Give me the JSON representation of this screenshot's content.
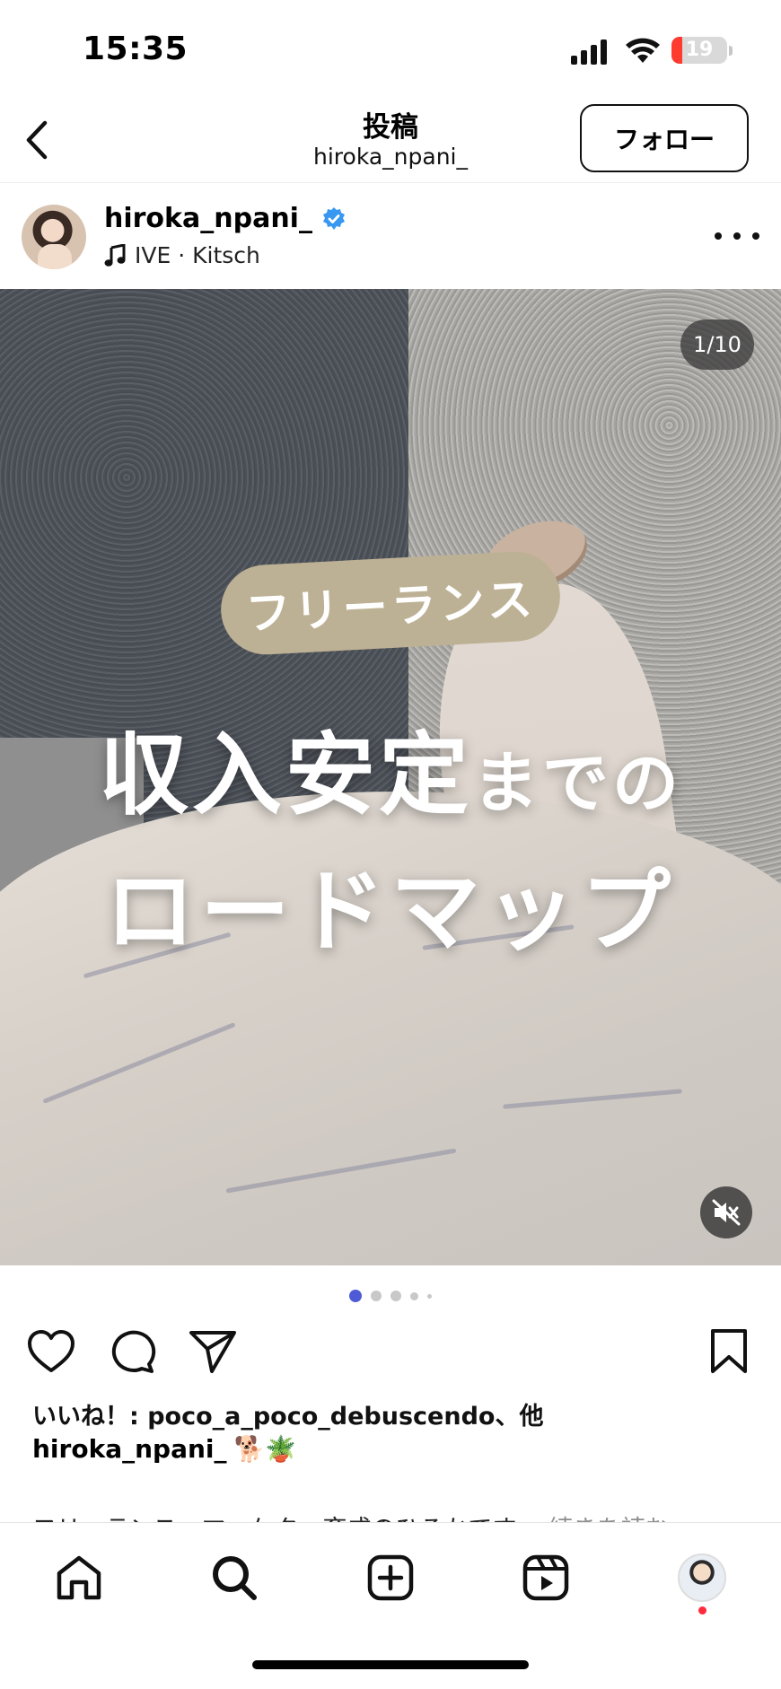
{
  "status_bar": {
    "time": "15:35",
    "battery": "19",
    "battery_level": 0.19
  },
  "nav": {
    "title": "投稿",
    "subtitle": "hiroka_npani_",
    "follow_label": "フォロー"
  },
  "post": {
    "username": "hiroka_npani_",
    "verified": true,
    "music": "IVE · Kitsch",
    "counter": "1/10",
    "overlay": {
      "tag": "フリーランス",
      "headline_big": "収入安定",
      "headline_small": "までの",
      "headline_line2": "ロードマップ"
    },
    "carousel_total_dots": 5,
    "carousel_active_index": 0
  },
  "engagement": {
    "likes_prefix": "いいね！: ",
    "likes_user": "poco_a_poco_debuscendo",
    "likes_suffix": "、他",
    "caption_user": "hiroka_npani_",
    "caption_emoji": "🐕🪴",
    "caption_text": "フリーランス・マーケター育成のひろかです…",
    "caption_more": "続きを読む"
  },
  "icons": {
    "back": "chevron-left-icon",
    "verified": "verified-badge-icon",
    "music": "music-note-icon",
    "more": "more-horizontal-icon",
    "mute": "speaker-muted-icon",
    "like": "heart-icon",
    "comment": "comment-icon",
    "share": "send-icon",
    "save": "bookmark-icon",
    "home": "home-icon",
    "search": "search-icon",
    "create": "plus-square-icon",
    "reels": "reels-icon"
  },
  "colors": {
    "accent_blue": "#3897f0",
    "dot_active": "#4f5bd5",
    "notification": "#ff2a3c",
    "tag_pill": "#bdb195"
  }
}
